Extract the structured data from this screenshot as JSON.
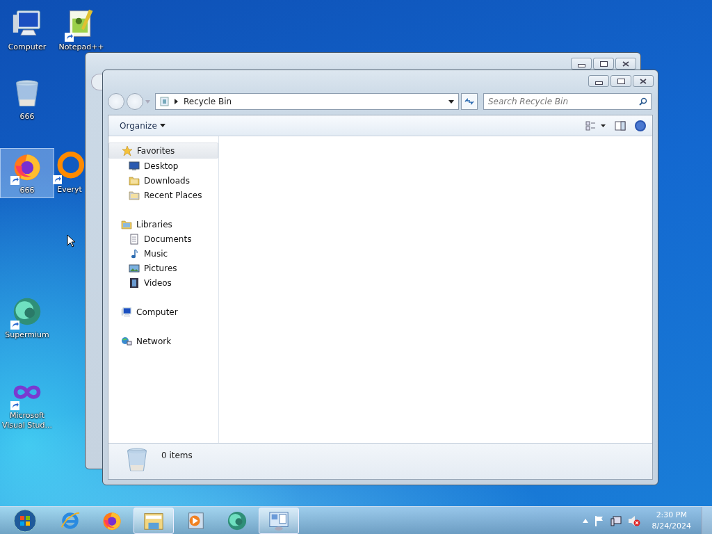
{
  "desktop_icons": [
    {
      "label": "Computer",
      "kind": "computer",
      "selected": false,
      "shortcut": false
    },
    {
      "label": "Notepad++",
      "kind": "notepad",
      "selected": false,
      "shortcut": true
    },
    {
      "label": "666",
      "kind": "recycle",
      "selected": false,
      "shortcut": false
    },
    {
      "label": "666",
      "kind": "firefox",
      "selected": true,
      "shortcut": true
    },
    {
      "label": "Everyt",
      "kind": "search",
      "selected": false,
      "shortcut": true
    },
    {
      "label": "Supermium",
      "kind": "supermium",
      "selected": false,
      "shortcut": true
    },
    {
      "label": "Microsoft Visual Stud...",
      "kind": "vs",
      "selected": false,
      "shortcut": true
    }
  ],
  "explorer": {
    "address": {
      "path": "Recycle Bin"
    },
    "search": {
      "placeholder": "Search Recycle Bin"
    },
    "toolbar": {
      "organize": "Organize"
    },
    "navigation": [
      {
        "label": "Favorites",
        "kind": "star",
        "selected": true,
        "children": [
          {
            "label": "Desktop",
            "kind": "desktop",
            "selected": false
          },
          {
            "label": "Downloads",
            "kind": "downloads",
            "selected": false
          },
          {
            "label": "Recent Places",
            "kind": "recent",
            "selected": false
          }
        ]
      },
      {
        "label": "Libraries",
        "kind": "library",
        "selected": false,
        "children": [
          {
            "label": "Documents",
            "kind": "documents",
            "selected": false
          },
          {
            "label": "Music",
            "kind": "music",
            "selected": false
          },
          {
            "label": "Pictures",
            "kind": "pictures",
            "selected": false
          },
          {
            "label": "Videos",
            "kind": "videos",
            "selected": false
          }
        ]
      },
      {
        "label": "Computer",
        "kind": "computer",
        "selected": false
      },
      {
        "label": "Network",
        "kind": "network",
        "selected": false
      }
    ],
    "status": {
      "count": "0 items"
    }
  },
  "taskbar": {
    "items": [
      {
        "kind": "ie",
        "active": false
      },
      {
        "kind": "firefox",
        "active": false
      },
      {
        "kind": "explorer",
        "active": true
      },
      {
        "kind": "media",
        "active": false
      },
      {
        "kind": "supermium",
        "active": false
      },
      {
        "kind": "control",
        "active": true
      }
    ],
    "clock": {
      "time": "2:30 PM",
      "date": "8/24/2024"
    }
  }
}
